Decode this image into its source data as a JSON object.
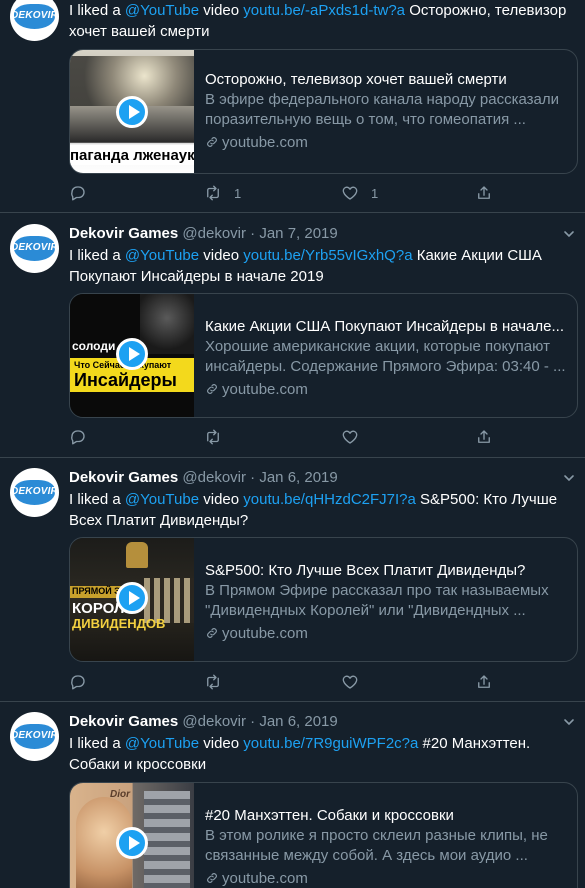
{
  "tweets": [
    {
      "name": "",
      "handle": "",
      "date": "",
      "text_prefix": "I liked a ",
      "mention": "@YouTube",
      "text_mid": " video ",
      "url": "youtu.be/-aPxds1d-tw?a",
      "text_suffix": " Осторожно, телевизор хочет вашей смерти",
      "card": {
        "title": "Осторожно, телевизор хочет вашей смерти",
        "description": "В эфире федерального канала народу рассказали поразительную вещь о том, что гомеопатия ...",
        "domain": "youtube.com",
        "thumb_text": "паганда лженауки"
      },
      "reply_count": "",
      "retweet_count": "1",
      "like_count": "1"
    },
    {
      "name": "Dekovir Games",
      "handle": "@dekovir",
      "date": "Jan 7, 2019",
      "text_prefix": "I liked a ",
      "mention": "@YouTube",
      "text_mid": " video ",
      "url": "youtu.be/Yrb55vIGxhQ?a",
      "text_suffix": " Какие Акции США Покупают Инсайдеры в начале 2019",
      "card": {
        "title": "Какие Акции США Покупают Инсайдеры в начале...",
        "description": "Хорошие американские акции, которые покупают инсайдеры. Содержание Прямого Эфира: 03:40 - ...",
        "domain": "youtube.com",
        "thumb_text_top": "солоди",
        "thumb_text_small": "Что Сейчас Покупают",
        "thumb_text": "Инсайдеры"
      },
      "reply_count": "",
      "retweet_count": "",
      "like_count": ""
    },
    {
      "name": "Dekovir Games",
      "handle": "@dekovir",
      "date": "Jan 6, 2019",
      "text_prefix": "I liked a ",
      "mention": "@YouTube",
      "text_mid": " video ",
      "url": "youtu.be/qHHzdC2FJ7I?a",
      "text_suffix": " S&P500: Кто Лучше Всех Платит Дивиденды?",
      "card": {
        "title": "S&P500: Кто Лучше Всех Платит Дивиденды?",
        "description": "В Прямом Эфире рассказал про так называемых \"Дивидендных Королей\" или \"Дивидендных ...",
        "domain": "youtube.com",
        "thumb_text_top": "ПРЯМОЙ ЭФ",
        "thumb_text": "КОРОЛИ",
        "thumb_text_2": "ДИВИДЕНДОВ"
      },
      "reply_count": "",
      "retweet_count": "",
      "like_count": ""
    },
    {
      "name": "Dekovir Games",
      "handle": "@dekovir",
      "date": "Jan 6, 2019",
      "text_prefix": "I liked a ",
      "mention": "@YouTube",
      "text_mid": " video ",
      "url": "youtu.be/7R9guiWPF2c?a",
      "text_suffix": " #20 Манхэттен. Собаки и кроссовки",
      "card": {
        "title": "#20 Манхэттен. Собаки и кроссовки",
        "description": "В этом ролике я просто склеил разные клипы, не связанные между собой. А здесь мои аудио ...",
        "domain": "youtube.com",
        "thumb_text": "Dior"
      },
      "reply_count": "",
      "retweet_count": "",
      "like_count": ""
    }
  ],
  "avatar_text": "DEKOVIR",
  "colors": {
    "background": "#15202b",
    "accent": "#1da1f2",
    "muted": "#8899a6",
    "border": "#38444d"
  }
}
